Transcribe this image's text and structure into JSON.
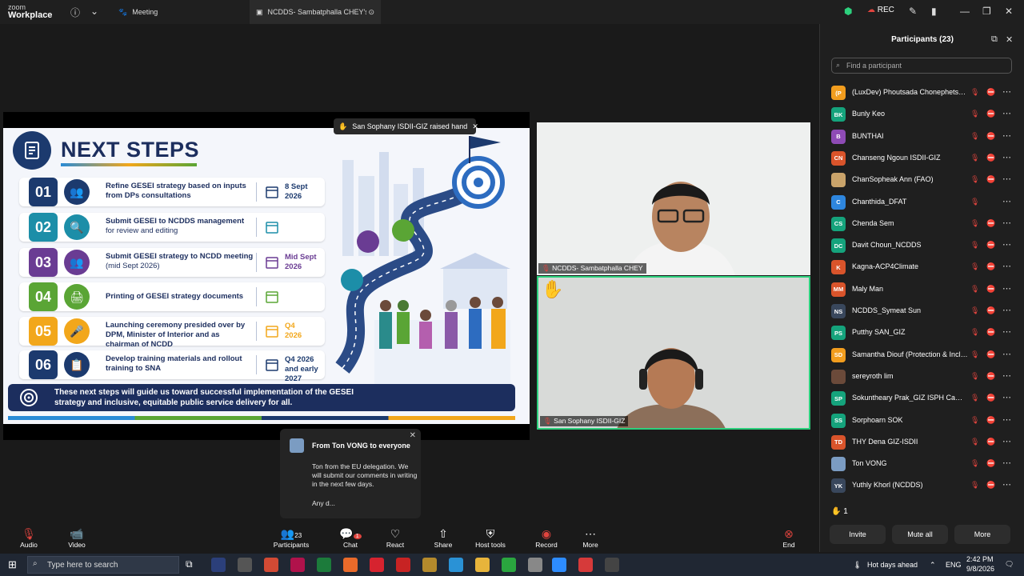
{
  "window": {
    "app_name_small": "zoom",
    "app_name": "Workplace",
    "tabs": [
      {
        "label": "Meeting"
      },
      {
        "label": "NCDDS- Sambatphalla CHEY's sc"
      }
    ],
    "rec_label": "REC"
  },
  "slide": {
    "title": "NEXT STEPS",
    "raised_hand": "San Sophany ISDII-GIZ raised hand",
    "steps": [
      {
        "num": "01",
        "text": "Refine GESEI strategy based on inputs from DPs consultations",
        "date_line1": "8 Sept",
        "date_line2": "2026",
        "color": "#1c3a6e"
      },
      {
        "num": "02",
        "text": "Submit GESEI to NCDDS management",
        "sub": "for review and editing",
        "date_line1": "",
        "date_line2": "",
        "color": "#1c8ea8"
      },
      {
        "num": "03",
        "text": "Submit GESEI strategy to NCDD meeting",
        "sub": "(mid Sept 2026)",
        "date_line1": "Mid Sept",
        "date_line2": "2026",
        "color": "#6a3c93"
      },
      {
        "num": "04",
        "text": "Printing of GESEI strategy documents",
        "date_line1": "",
        "date_line2": "",
        "color": "#5aa535"
      },
      {
        "num": "05",
        "text": "Launching ceremony presided over by DPM, Minister of Interior and as chairman of NCDD",
        "date_line1": "Q4",
        "date_line2": "2026",
        "color": "#f2a71b"
      },
      {
        "num": "06",
        "text": "Develop training materials and rollout training to SNA",
        "date_line1": "Q4 2026",
        "date_line2": "and early 2027",
        "color": "#1c3a6e"
      }
    ],
    "banner": "These next steps will guide us toward successful implementation of the GESEI strategy and inclusive, equitable public service delivery for all."
  },
  "videos": [
    {
      "name": "NCDDS- Sambatphalla CHEY"
    },
    {
      "name": "San Sophany  ISDII-GIZ"
    }
  ],
  "chat_popup": {
    "from": "From Ton VONG to everyone",
    "message": "Ton from the EU delegation. We will submit our comments in writing in the next few days.",
    "more": "Any d..."
  },
  "participants": {
    "title": "Participants (23)",
    "search_placeholder": "Find a participant",
    "list": [
      {
        "initials": "(P",
        "name": "(LuxDev) Phoutsada Chonephetsala...",
        "color": "#f29d1e",
        "cam_off": true
      },
      {
        "initials": "BK",
        "name": "Bunly Keo",
        "color": "#15a37c",
        "cam_off": true
      },
      {
        "initials": "B",
        "name": "BUNTHAI",
        "color": "#8e4bb5",
        "cam_off": true
      },
      {
        "initials": "CN",
        "name": "Chanseng Ngoun ISDII-GIZ",
        "color": "#d9542b",
        "cam_off": true
      },
      {
        "initials": "",
        "name": "ChanSopheak Ann (FAO)",
        "color": "#c9a36a",
        "cam_off": true
      },
      {
        "initials": "C",
        "name": "Chanthida_DFAT",
        "color": "#2e86de",
        "cam_off": false
      },
      {
        "initials": "CS",
        "name": "Chenda Sem",
        "color": "#15a37c",
        "cam_off": true
      },
      {
        "initials": "DC",
        "name": "Davit Choun_NCDDS",
        "color": "#15a37c",
        "cam_off": true
      },
      {
        "initials": "K",
        "name": "Kagna-ACP4Climate",
        "color": "#d9542b",
        "cam_off": true
      },
      {
        "initials": "MM",
        "name": "Maly Man",
        "color": "#d9542b",
        "cam_off": true
      },
      {
        "initials": "NS",
        "name": "NCDDS_Symeat Sun",
        "color": "#39475c",
        "cam_off": true
      },
      {
        "initials": "PS",
        "name": "Putthy SAN_GIZ",
        "color": "#15a37c",
        "cam_off": true
      },
      {
        "initials": "SD",
        "name": "Samantha Diouf (Protection & Inclu...",
        "color": "#f29d1e",
        "cam_off": true
      },
      {
        "initials": "",
        "name": "sereyroth lim",
        "color": "#6b4a3a",
        "cam_off": true
      },
      {
        "initials": "SP",
        "name": "Sokuntheary Prak_GIZ ISPH Cambo...",
        "color": "#15a37c",
        "cam_off": true
      },
      {
        "initials": "SS",
        "name": "Sorphoarn SOK",
        "color": "#15a37c",
        "cam_off": true
      },
      {
        "initials": "TD",
        "name": "THY Dena GIZ-ISDII",
        "color": "#d9542b",
        "cam_off": true
      },
      {
        "initials": "",
        "name": "Ton VONG",
        "color": "#7b9cc2",
        "cam_off": true
      },
      {
        "initials": "YK",
        "name": "Yuthly Khorl (NCDDS)",
        "color": "#39475c",
        "cam_off": true
      }
    ],
    "hand_count": "1",
    "buttons": {
      "invite": "Invite",
      "mute_all": "Mute all",
      "more": "More"
    }
  },
  "toolbar": {
    "audio": "Audio",
    "video": "Video",
    "participants": "Participants",
    "participants_count": "23",
    "chat": "Chat",
    "chat_badge": "1",
    "react": "React",
    "share": "Share",
    "host_tools": "Host tools",
    "record": "Record",
    "more": "More",
    "end": "End"
  },
  "taskbar": {
    "search_placeholder": "Type here to search",
    "weather": "Hot days ahead",
    "lang": "ENG",
    "time": "2:42 PM",
    "date": "9/8/2026"
  }
}
